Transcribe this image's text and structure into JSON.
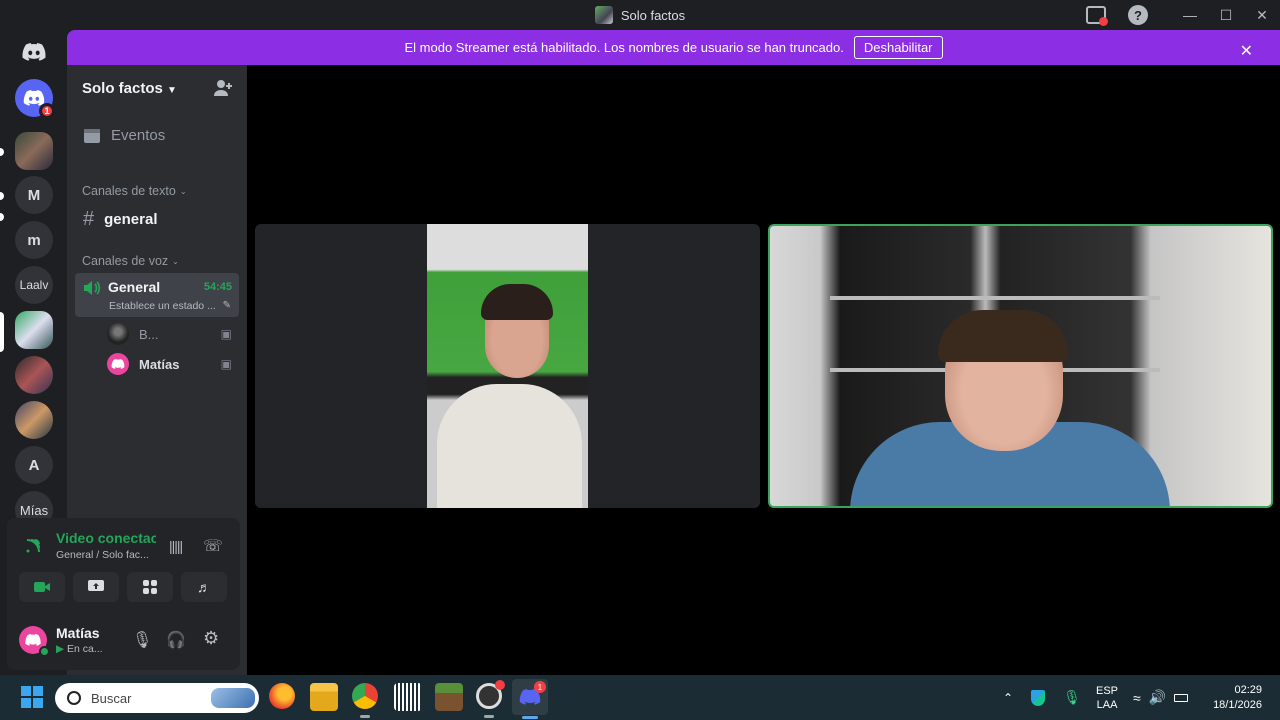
{
  "window": {
    "title": "Solo factos"
  },
  "banner": {
    "message": "El modo Streamer está habilitado. Los nombres de usuario se han truncado.",
    "button": "Deshabilitar"
  },
  "guilds": {
    "badge_count": "1",
    "letters": [
      "M",
      "m",
      "Laalv",
      "A",
      "Mías"
    ]
  },
  "server": {
    "name": "Solo factos",
    "events_label": "Eventos",
    "text_category": "Canales de texto",
    "text_channel": "general",
    "voice_category": "Canales de voz",
    "voice_channel": "General",
    "voice_timer": "54:45",
    "voice_status": "Establece un estado ...",
    "members": [
      {
        "name": "B..."
      },
      {
        "name": "Matías"
      }
    ]
  },
  "voice_panel": {
    "status": "Video conectac",
    "location": "General / Solo fac...",
    "user_name": "Matías",
    "user_status": "En ca..."
  },
  "colors": {
    "accent": "#8c2ee3",
    "connected_green": "#23a55a",
    "speaking_border": "#3ba55d"
  },
  "taskbar": {
    "search_placeholder": "Buscar",
    "discord_badge": "1",
    "lang_top": "ESP",
    "lang_bottom": "LAA",
    "time": "02:29",
    "date": "18/1/2026"
  }
}
